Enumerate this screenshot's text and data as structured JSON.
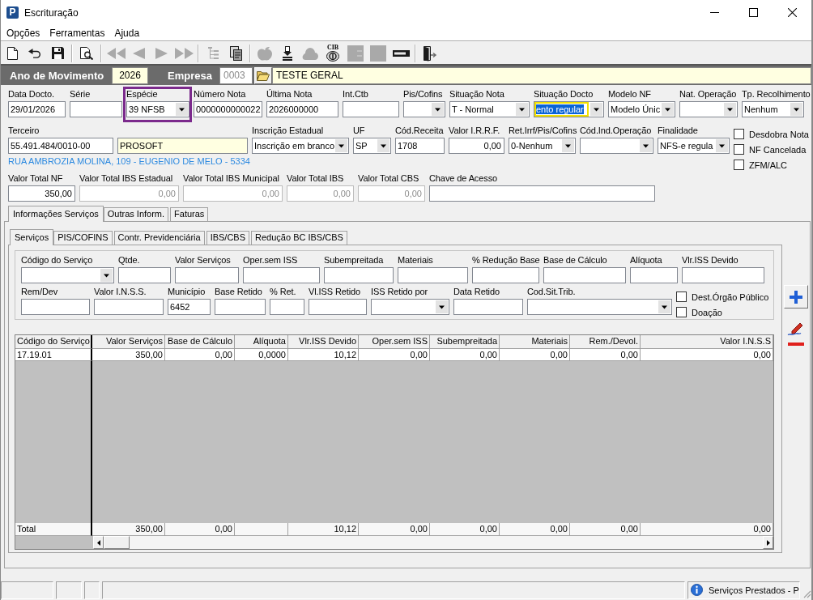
{
  "window": {
    "logo_text": "P",
    "title": "Escrituração"
  },
  "menu": [
    {
      "label": "Opções"
    },
    {
      "label": "Ferramentas"
    },
    {
      "label": "Ajuda"
    }
  ],
  "toolbar": {
    "groups": [
      [
        {
          "disabled": false
        },
        {
          "disabled": false
        },
        {
          "disabled": false
        }
      ],
      [
        {
          "disabled": false
        }
      ],
      [
        {
          "disabled": true
        },
        {
          "disabled": true
        },
        {
          "disabled": true
        },
        {
          "disabled": true
        }
      ],
      [
        {
          "disabled": true
        },
        {
          "disabled": false
        }
      ],
      [
        {
          "disabled": true
        },
        {
          "disabled": false
        },
        {
          "disabled": true
        },
        {
          "disabled": false,
          "label": "CIB"
        },
        {
          "disabled": true
        },
        {
          "disabled": true
        },
        {
          "disabled": false
        }
      ],
      [
        {
          "disabled": false
        }
      ]
    ]
  },
  "year_bar": {
    "year_label": "Ano de Movimento",
    "year": "2026",
    "company_label": "Empresa",
    "company_code": "0003",
    "company_code_disabled": true,
    "company_name": "TESTE GERAL"
  },
  "document": {
    "row_1": [
      {
        "label": "Data Docto.",
        "kind": "text",
        "value": "29/01/2026",
        "highlighted": false,
        "focused": false
      },
      {
        "label": "Série",
        "kind": "text",
        "highlighted": false,
        "focused": false
      },
      {
        "label": "Espécie",
        "kind": "combo",
        "value": "39 NFSB",
        "highlighted": true,
        "focused": false
      },
      {
        "label": "Número Nota",
        "kind": "text",
        "value": "0000000000022",
        "highlighted": false,
        "focused": false
      },
      {
        "label": "Última Nota",
        "kind": "text",
        "value": "2026000000",
        "highlighted": false,
        "focused": false
      },
      {
        "label": "Int.Ctb",
        "kind": "text",
        "highlighted": false,
        "focused": false
      },
      {
        "label": "Pis/Cofins",
        "kind": "combo",
        "highlighted": false,
        "focused": false
      },
      {
        "label": "Situação Nota",
        "kind": "combo",
        "value": "T - Normal",
        "highlighted": false,
        "focused": false
      },
      {
        "label": "Situação Docto",
        "kind": "combo",
        "value": "ento regular",
        "highlighted": false,
        "focused": true
      },
      {
        "label": "Modelo NF",
        "kind": "combo",
        "value": "Modelo Únic",
        "highlighted": false,
        "focused": false
      },
      {
        "label": "Nat. Operação",
        "kind": "combo",
        "highlighted": false,
        "focused": false
      },
      {
        "label": "Tp. Recolhimento",
        "kind": "combo",
        "value": "Nenhum",
        "highlighted": false,
        "focused": false
      }
    ],
    "row_2": [
      {
        "label": "Terceiro",
        "kind": "text",
        "value": "55.491.484/0010-00"
      },
      {
        "kind": "lookup",
        "value": "PROSOFT"
      },
      {
        "label": "Inscrição Estadual",
        "kind": "combo",
        "value": "Inscrição em branco"
      },
      {
        "label": "UF",
        "kind": "combo",
        "value": "SP"
      },
      {
        "label": "Cód.Receita",
        "kind": "text",
        "value": "1708"
      },
      {
        "label": "Valor I.R.R.F.",
        "kind": "number",
        "value": "0,00"
      },
      {
        "label": "Ret.Irrf/Pis/Cofins",
        "kind": "combo",
        "value": "0-Nenhum"
      },
      {
        "label": "Cód.Ind.Operação",
        "kind": "combo"
      },
      {
        "label": "Finalidade",
        "kind": "combo",
        "value": "NFS-e regula"
      }
    ],
    "address": "RUA AMBROZIA MOLINA, 109 - EUGENIO DE MELO - 5334",
    "flags": [
      {
        "label": "Desdobra Nota",
        "checked": false
      },
      {
        "label": "NF Cancelada",
        "checked": false
      },
      {
        "label": "ZFM/ALC",
        "checked": false
      }
    ],
    "row_3": [
      {
        "label": "Valor Total NF",
        "kind": "number",
        "value": "350,00",
        "disabled": false
      },
      {
        "label": "Valor Total IBS Estadual",
        "kind": "number",
        "value": "0,00",
        "disabled": true
      },
      {
        "label": "Valor Total IBS Municipal",
        "kind": "number",
        "value": "0,00",
        "disabled": true
      },
      {
        "label": "Valor Total IBS",
        "kind": "number",
        "value": "0,00",
        "disabled": true
      },
      {
        "label": "Valor Total CBS",
        "kind": "number",
        "value": "0,00",
        "disabled": true
      },
      {
        "label": "Chave de Acesso",
        "kind": "text",
        "disabled": false
      }
    ]
  },
  "tabs": [
    {
      "label": "Informações Serviços",
      "selected": true
    },
    {
      "label": "Outras Inform.",
      "selected": false
    },
    {
      "label": "Faturas",
      "selected": false
    }
  ],
  "subtabs": [
    {
      "label": "Serviços",
      "selected": true
    },
    {
      "label": "PIS/COFINS",
      "selected": false
    },
    {
      "label": "Contr. Previdenciária",
      "selected": false
    },
    {
      "label": "IBS/CBS",
      "selected": false
    },
    {
      "label": "Redução BC IBS/CBS",
      "selected": false
    }
  ],
  "service_form": {
    "row_1": [
      {
        "label": "Código do Serviço",
        "kind": "combo"
      },
      {
        "label": "Qtde.",
        "kind": "text"
      },
      {
        "label": "Valor Serviços",
        "kind": "text"
      },
      {
        "label": "Oper.sem ISS",
        "kind": "text"
      },
      {
        "label": "Subempreitada",
        "kind": "text"
      },
      {
        "label": "Materiais",
        "kind": "text"
      },
      {
        "label": "% Redução Base",
        "kind": "text"
      },
      {
        "label": "Base de Cálculo",
        "kind": "text"
      },
      {
        "label": "Alíquota",
        "kind": "text"
      },
      {
        "label": "Vlr.ISS Devido",
        "kind": "text"
      }
    ],
    "row_2": [
      {
        "label": "Rem/Dev",
        "kind": "text"
      },
      {
        "label": "Valor I.N.S.S.",
        "kind": "text"
      },
      {
        "label": "Município",
        "kind": "text",
        "value": "6452"
      },
      {
        "label": "Base Retido",
        "kind": "text"
      },
      {
        "label": "% Ret.",
        "kind": "text"
      },
      {
        "label": "Vl.ISS Retido",
        "kind": "text"
      },
      {
        "label": "ISS Retido por",
        "kind": "combo"
      },
      {
        "label": "Data Retido",
        "kind": "text"
      },
      {
        "label": "Cod.Sit.Trib.",
        "kind": "combo"
      }
    ],
    "flags": [
      {
        "label": "Dest.Órgão Público",
        "checked": false
      },
      {
        "label": "Doação",
        "checked": false
      }
    ]
  },
  "grid": {
    "columns": [
      "Código do Serviço",
      "Valor Serviços",
      "Base de Cálculo",
      "Alíquota",
      "Vlr.ISS Devido",
      "Oper.sem ISS",
      "Subempreitada",
      "Materiais",
      "Rem./Devol.",
      "Valor I.N.S.S"
    ],
    "rows": [
      [
        "17.19.01",
        "350,00",
        "0,00",
        "0,0000",
        "10,12",
        "0,00",
        "0,00",
        "0,00",
        "0,00",
        "0,00"
      ]
    ],
    "totals": {
      "codigo_do_servico": "Total",
      "valor_servicos": "350,00",
      "base_de_calculo": "0,00",
      "vlr_iss_devido": "10,12",
      "oper_sem_iss": "0,00",
      "subempreitada": "0,00",
      "materiais": "0,00",
      "rem_devol": "0,00",
      "valor_inss": "0,00"
    }
  },
  "status_bar": {
    "text": "Serviços Prestados - P"
  }
}
